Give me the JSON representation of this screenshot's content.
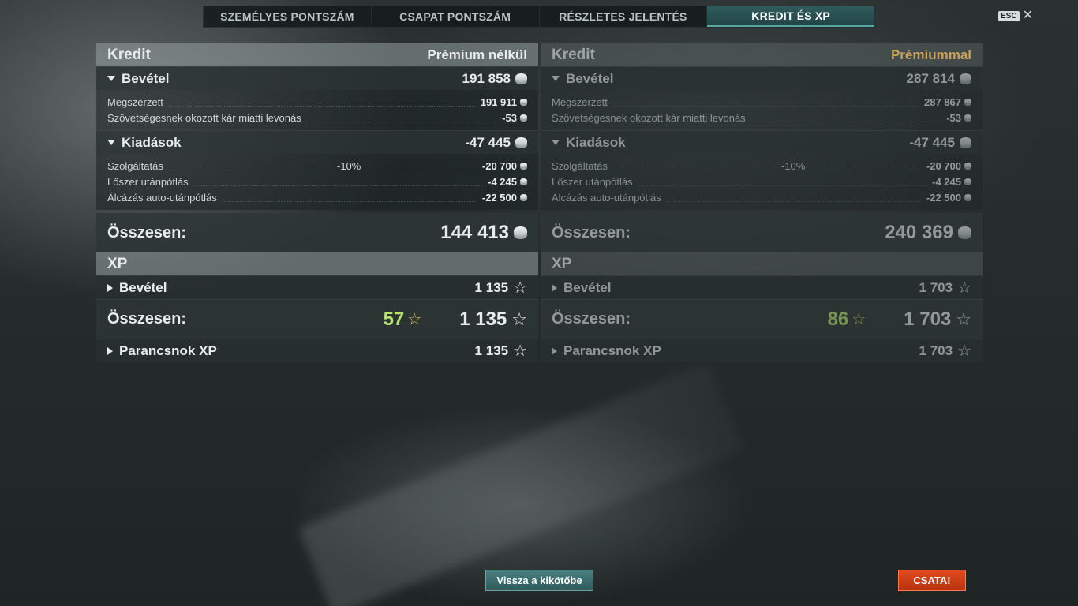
{
  "tabs": [
    {
      "label": "SZEMÉLYES PONTSZÁM",
      "active": false
    },
    {
      "label": "CSAPAT PONTSZÁM",
      "active": false
    },
    {
      "label": "RÉSZLETES JELENTÉS",
      "active": false
    },
    {
      "label": "KREDIT ÉS XP",
      "active": true
    }
  ],
  "esc_label": "ESC",
  "left": {
    "kredit_title": "Kredit",
    "column_title": "Prémium nélkül",
    "income": {
      "label": "Bevétel",
      "value": "191 858",
      "rows": [
        {
          "name": "Megszerzett",
          "value": "191 911"
        },
        {
          "name": "Szövetségesnek okozott kár miatti levonás",
          "value": "-53"
        }
      ]
    },
    "expenses": {
      "label": "Kiadások",
      "value": "-47 445",
      "rows": [
        {
          "name": "Szolgáltatás",
          "pct": "-10%",
          "value": "-20 700"
        },
        {
          "name": "Lőszer utánpótlás",
          "value": "-4 245"
        },
        {
          "name": "Álcázás auto-utánpótlás",
          "value": "-22 500"
        }
      ]
    },
    "total_label": "Összesen:",
    "total_value": "144 413",
    "xp_title": "XP",
    "xp_income_label": "Bevétel",
    "xp_income_value": "1 135",
    "xp_total_label": "Összesen:",
    "xp_free_value": "57",
    "xp_total_value": "1 135",
    "commander_label": "Parancsnok XP",
    "commander_value": "1 135"
  },
  "right": {
    "kredit_title": "Kredit",
    "column_title": "Prémiummal",
    "income": {
      "label": "Bevétel",
      "value": "287 814",
      "rows": [
        {
          "name": "Megszerzett",
          "value": "287 867"
        },
        {
          "name": "Szövetségesnek okozott kár miatti levonás",
          "value": "-53"
        }
      ]
    },
    "expenses": {
      "label": "Kiadások",
      "value": "-47 445",
      "rows": [
        {
          "name": "Szolgáltatás",
          "pct": "-10%",
          "value": "-20 700"
        },
        {
          "name": "Lőszer utánpótlás",
          "value": "-4 245"
        },
        {
          "name": "Álcázás auto-utánpótlás",
          "value": "-22 500"
        }
      ]
    },
    "total_label": "Összesen:",
    "total_value": "240 369",
    "xp_title": "XP",
    "xp_income_label": "Bevétel",
    "xp_income_value": "1 703",
    "xp_total_label": "Összesen:",
    "xp_free_value": "86",
    "xp_total_value": "1 703",
    "commander_label": "Parancsnok XP",
    "commander_value": "1 703"
  },
  "buttons": {
    "back_label": "Vissza a kikötőbe",
    "battle_label": "CSATA!"
  },
  "colors": {
    "accent_teal": "#2f5b5c",
    "premium_gold": "#c9a25c",
    "free_xp_green": "#b6e36b",
    "battle_red": "#d0401a"
  },
  "icons": {
    "credit": "credit-coin-icon",
    "xp": "xp-star-icon",
    "close": "close-icon"
  }
}
